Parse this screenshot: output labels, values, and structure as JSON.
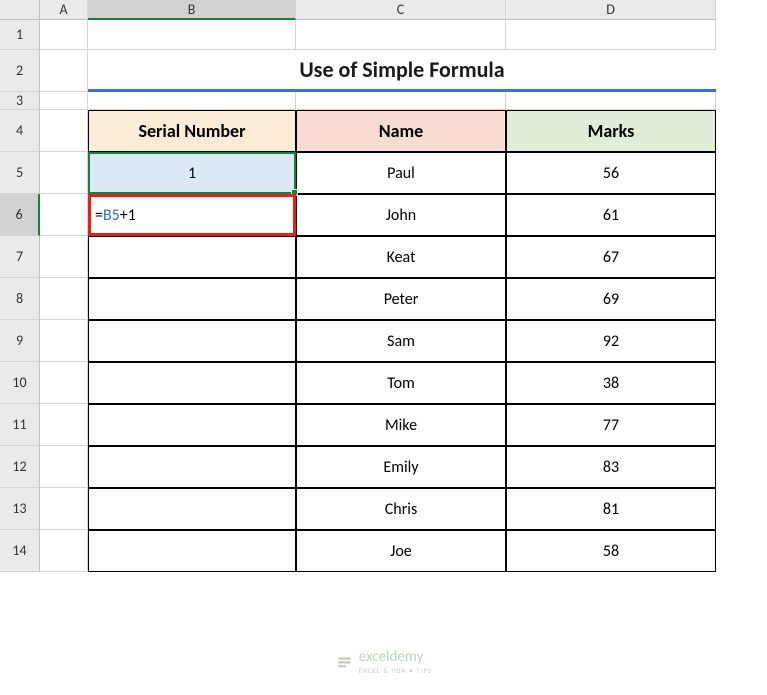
{
  "columns": [
    "A",
    "B",
    "C",
    "D"
  ],
  "rows": [
    "1",
    "2",
    "3",
    "4",
    "5",
    "6",
    "7",
    "8",
    "9",
    "10",
    "11",
    "12",
    "13",
    "14"
  ],
  "title": "Use of Simple Formula",
  "headers": {
    "serial": "Serial Number",
    "name": "Name",
    "marks": "Marks"
  },
  "selected_value": "1",
  "formula": {
    "prefix": "=",
    "ref": "B5",
    "suffix": "+1"
  },
  "data_rows": [
    {
      "name": "Paul",
      "marks": "56"
    },
    {
      "name": "John",
      "marks": "61"
    },
    {
      "name": "Keat",
      "marks": "67"
    },
    {
      "name": "Peter",
      "marks": "69"
    },
    {
      "name": "Sam",
      "marks": "92"
    },
    {
      "name": "Tom",
      "marks": "38"
    },
    {
      "name": "Mike",
      "marks": "77"
    },
    {
      "name": "Emily",
      "marks": "83"
    },
    {
      "name": "Chris",
      "marks": "81"
    },
    {
      "name": "Joe",
      "marks": "58"
    }
  ],
  "watermark": {
    "brand": "exceldemy",
    "tagline": "EXCEL & VBA • TIPS"
  },
  "active": {
    "column": "B",
    "row": "6"
  }
}
